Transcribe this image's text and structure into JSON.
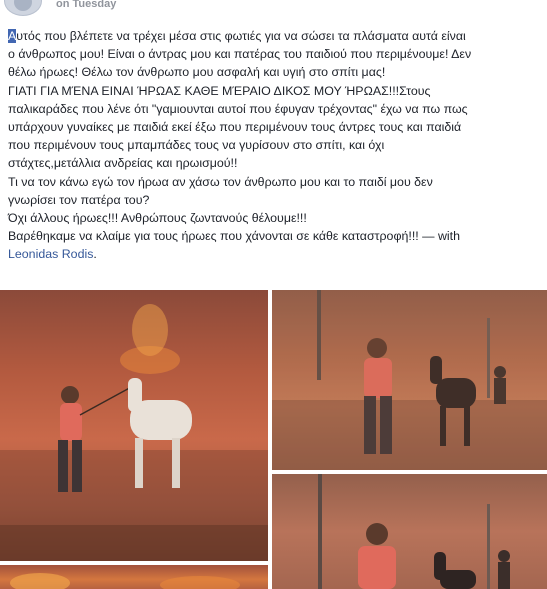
{
  "post": {
    "timestamp": "on Tuesday",
    "lines": {
      "l1_highlight": "Α",
      "l1_rest": "υτός που βλέπετε να τρέχει μέσα στις φωτιές για να σώσει τα πλάσματα αυτά είναι",
      "l2": "ο άνθρωπος μου! Είναι ο άντρας μου και πατέρας του παιδιού που περιμένουμε! Δεν",
      "l3": "θέλω ήρωες! Θέλω τον άνθρωπο μου ασφαλή και υγιή στο σπίτι μας!",
      "l4": "ΓΙΑΤΙ ΓΙΑ ΜΈΝΑ ΕΙΝΑΙ ΉΡΩΑΣ ΚΑΘΕ ΜΈΡΑΙΟ ΔΙΚΟΣ ΜΟΥ ΉΡΩΑΣ!!!Στους",
      "l5": "παλικαράδες που λένε ότι \"γαμιουνται αυτοί που έφυγαν τρέχοντας\" έχω να πω πως",
      "l6": "υπάρχουν γυναίκες με παιδιά εκεί έξω που περιμένουν τους άντρες τους και παιδιά",
      "l7": "που περιμένουν τους μπαμπάδες τους να γυρίσουν στο σπίτι, και όχι",
      "l8": "στάχτες,μετάλλια ανδρείας και ηρωισμού!!",
      "l9": "Τι να τον κάνω εγώ τον ήρωα αν χάσω τον άνθρωπο μου και το παιδί μου δεν",
      "l10": "γνωρίσει τον πατέρα του?",
      "l11": "Όχι άλλους ήρωες!!! Ανθρώπους ζωντανούς θέλουμε!!!",
      "l12_text": "Βαρέθηκαμε να κλαίμε για τους ήρωες που χάνονται σε κάθε καταστροφή!!! — with",
      "l13_tag": "Leonidas Rodis",
      "l13_end": "."
    }
  },
  "colors": {
    "text": "#1d2129",
    "link": "#365899",
    "highlight": "#4267b2",
    "meta": "#90949c"
  },
  "photos": [
    {
      "name": "man-with-white-horse-fire"
    },
    {
      "name": "man-with-donkey-smoke"
    },
    {
      "name": "man-with-donkey-smoke-closeup"
    },
    {
      "name": "fire-partial"
    }
  ]
}
